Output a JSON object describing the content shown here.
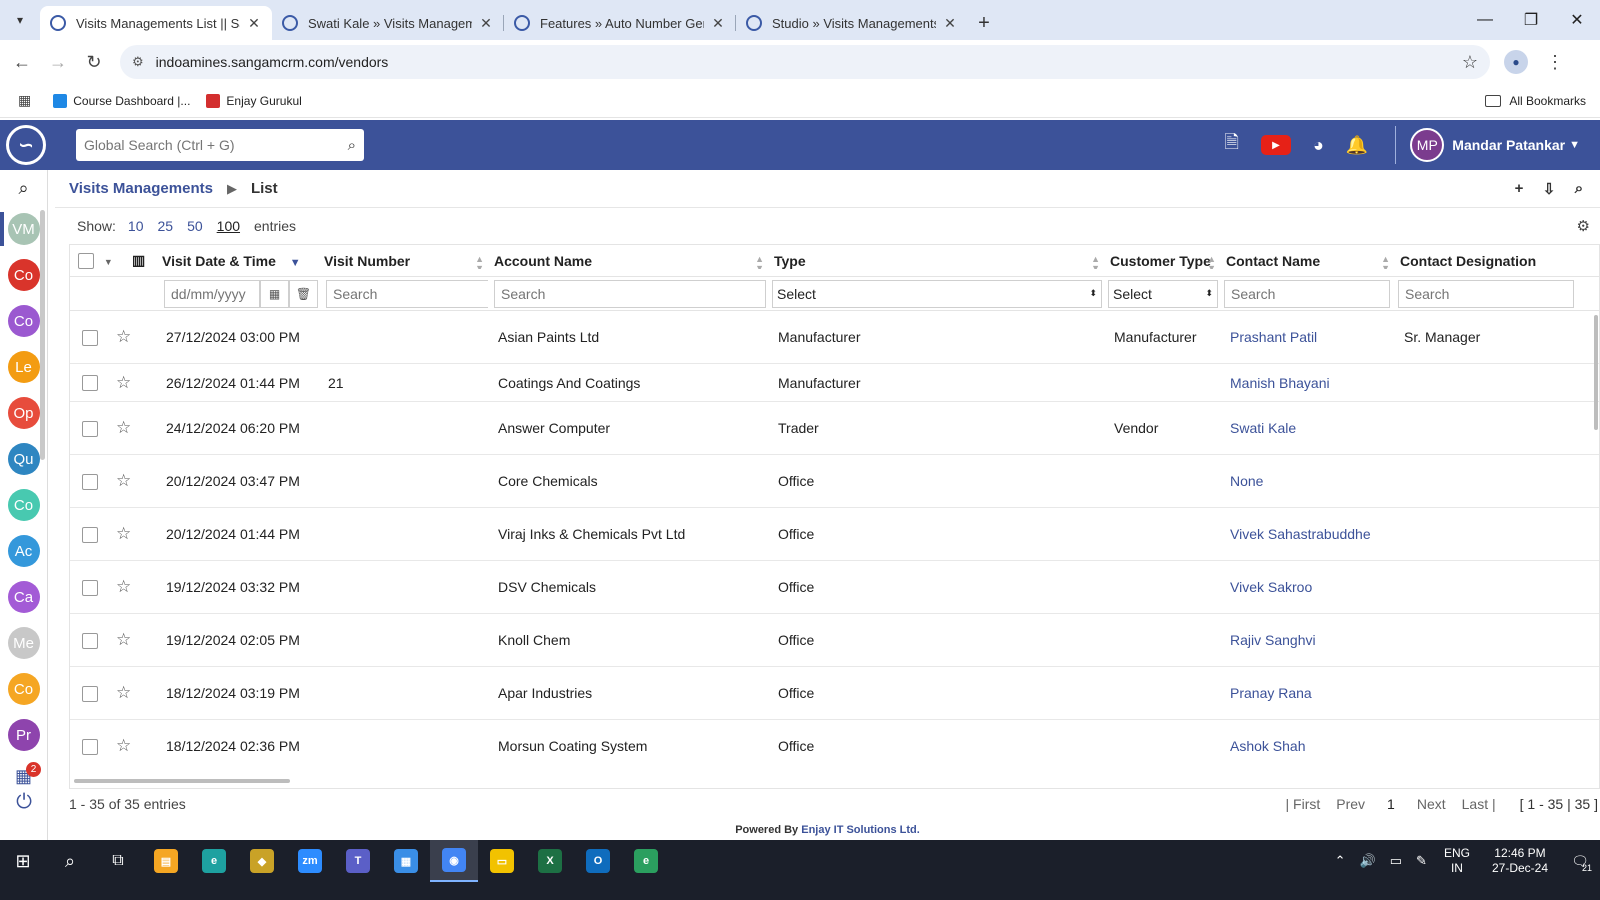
{
  "browser": {
    "tabs": [
      {
        "title": "Visits Managements List || Sang",
        "active": true
      },
      {
        "title": "Swati Kale » Visits Management",
        "active": false
      },
      {
        "title": "Features » Auto Number Gener",
        "active": false
      },
      {
        "title": "Studio » Visits Managements Fi",
        "active": false
      }
    ],
    "url": "indoamines.sangamcrm.com/vendors",
    "bookmarks": [
      {
        "label": "Course Dashboard |...",
        "color": "#1e88e5"
      },
      {
        "label": "Enjay Gurukul",
        "color": "#d32f2f"
      }
    ],
    "all_bookmarks": "All Bookmarks"
  },
  "header": {
    "search_placeholder": "Global Search (Ctrl + G)",
    "user_initials": "MP",
    "user_name": "Mandar Patankar",
    "accent": "#3c5299"
  },
  "sidebar": {
    "items": [
      {
        "initials": "VM",
        "color": "#a8c4b4",
        "active": true
      },
      {
        "initials": "Co",
        "color": "#d9342b"
      },
      {
        "initials": "Co",
        "color": "#9b59d0"
      },
      {
        "initials": "Le",
        "color": "#f39c12"
      },
      {
        "initials": "Op",
        "color": "#e74c3c"
      },
      {
        "initials": "Qu",
        "color": "#2e86c1"
      },
      {
        "initials": "Co",
        "color": "#48c9b0"
      },
      {
        "initials": "Ac",
        "color": "#3498db"
      },
      {
        "initials": "Ca",
        "color": "#a35bd6"
      },
      {
        "initials": "Me",
        "color": "#c8c8c8"
      },
      {
        "initials": "Co",
        "color": "#f5a623"
      },
      {
        "initials": "Pr",
        "color": "#8e44ad"
      }
    ],
    "notification_count": "2"
  },
  "breadcrumb": {
    "module": "Visits Managements",
    "current": "List"
  },
  "list": {
    "show_label": "Show:",
    "page_sizes": [
      "10",
      "25",
      "50",
      "100"
    ],
    "entries_label": "entries",
    "columns": {
      "visit_date": "Visit Date & Time",
      "visit_number": "Visit Number",
      "account_name": "Account Name",
      "type": "Type",
      "customer_type": "Customer Type",
      "contact_name": "Contact Name",
      "contact_designation": "Contact Designation"
    },
    "filters": {
      "date_placeholder": "dd/mm/yyyy",
      "search_placeholder": "Search",
      "select_label": "Select"
    },
    "rows": [
      {
        "date": "27/12/2024 03:00 PM",
        "number": "",
        "account": "Asian Paints Ltd",
        "type": "Manufacturer",
        "customer_type": "Manufacturer",
        "contact": "Prashant Patil",
        "designation": "Sr. Manager"
      },
      {
        "date": "26/12/2024 01:44 PM",
        "number": "21",
        "account": "Coatings And Coatings",
        "type": "Manufacturer",
        "customer_type": "",
        "contact": "Manish Bhayani",
        "designation": ""
      },
      {
        "date": "24/12/2024 06:20 PM",
        "number": "",
        "account": "Answer Computer",
        "type": "Trader",
        "customer_type": "Vendor",
        "contact": "Swati Kale",
        "designation": ""
      },
      {
        "date": "20/12/2024 03:47 PM",
        "number": "",
        "account": "Core Chemicals",
        "type": "Office",
        "customer_type": "",
        "contact": "None",
        "designation": ""
      },
      {
        "date": "20/12/2024 01:44 PM",
        "number": "",
        "account": "Viraj Inks & Chemicals Pvt Ltd",
        "type": "Office",
        "customer_type": "",
        "contact": "Vivek Sahastrabuddhe",
        "designation": ""
      },
      {
        "date": "19/12/2024 03:32 PM",
        "number": "",
        "account": "DSV Chemicals",
        "type": "Office",
        "customer_type": "",
        "contact": "Vivek Sakroo",
        "designation": ""
      },
      {
        "date": "19/12/2024 02:05 PM",
        "number": "",
        "account": "Knoll Chem",
        "type": "Office",
        "customer_type": "",
        "contact": "Rajiv Sanghvi",
        "designation": ""
      },
      {
        "date": "18/12/2024 03:19 PM",
        "number": "",
        "account": "Apar Industries",
        "type": "Office",
        "customer_type": "",
        "contact": "Pranay Rana",
        "designation": ""
      },
      {
        "date": "18/12/2024 02:36 PM",
        "number": "",
        "account": "Morsun Coating System",
        "type": "Office",
        "customer_type": "",
        "contact": "Ashok Shah",
        "designation": ""
      }
    ],
    "summary": "1 - 35 of 35 entries",
    "pager": {
      "first": "| First",
      "prev": "Prev",
      "page": "1",
      "next": "Next",
      "last": "Last |",
      "range": "[ 1 - 35 | 35 ]"
    }
  },
  "footer": {
    "powered_by": "Powered By",
    "company": "Enjay IT Solutions Ltd."
  },
  "taskbar": {
    "lang_top": "ENG",
    "lang_bottom": "IN",
    "time": "12:46 PM",
    "date": "27-Dec-24",
    "notif_count": "21",
    "apps": [
      {
        "name": "file-manager-app",
        "color": "#f5a623",
        "glyph": "▤"
      },
      {
        "name": "edge-app",
        "color": "#1ea1a0",
        "glyph": "e"
      },
      {
        "name": "app-icon",
        "color": "#c9a227",
        "glyph": "◆"
      },
      {
        "name": "zoom-app",
        "color": "#2d8cff",
        "glyph": "zm"
      },
      {
        "name": "teams-app",
        "color": "#5b5fc7",
        "glyph": "T"
      },
      {
        "name": "windows-app",
        "color": "#3a8ee6",
        "glyph": "▦"
      },
      {
        "name": "chrome-app",
        "color": "#4285f4",
        "glyph": "◉",
        "active": true
      },
      {
        "name": "explorer-app",
        "color": "#f2c200",
        "glyph": "▭"
      },
      {
        "name": "excel-app",
        "color": "#1d7044",
        "glyph": "X"
      },
      {
        "name": "outlook-app",
        "color": "#0f6cbd",
        "glyph": "O"
      },
      {
        "name": "edge-dev-app",
        "color": "#2b9f5f",
        "glyph": "e"
      }
    ]
  }
}
